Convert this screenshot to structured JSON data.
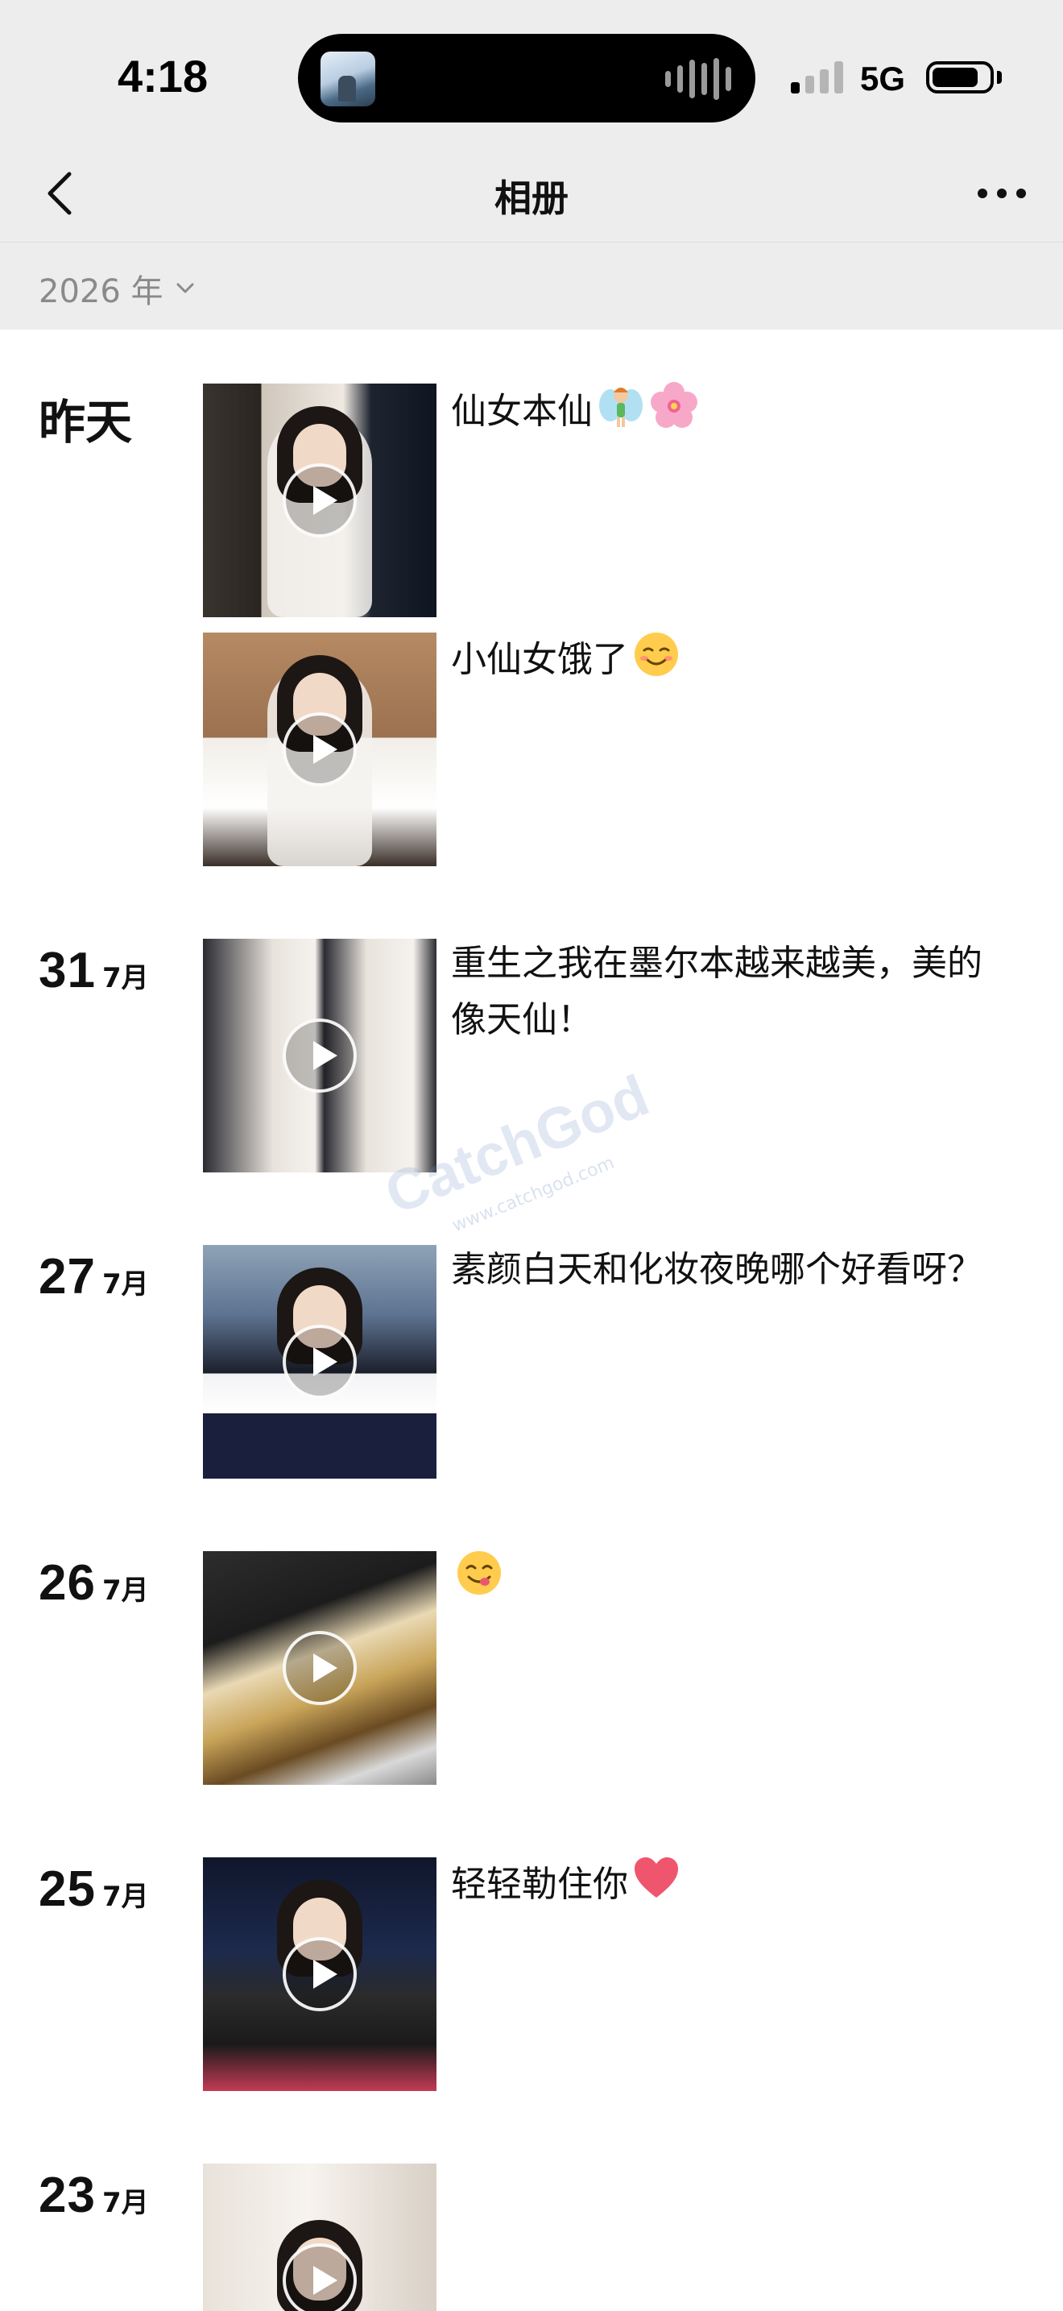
{
  "status_bar": {
    "time": "4:18",
    "network": "5G",
    "signal_bars_active": 1,
    "battery_level": 0.75
  },
  "nav": {
    "title": "相册",
    "back_icon": "chevron-left-icon",
    "more_icon": "ellipsis-icon"
  },
  "filter": {
    "year_label": "2026 年",
    "dropdown_icon": "chevron-down-icon"
  },
  "posts": [
    {
      "day": "昨天",
      "month": "",
      "caption": "仙女本仙",
      "emojis": [
        "fairy-emoji",
        "cherry-blossom-emoji"
      ]
    },
    {
      "day": "",
      "month": "",
      "caption": "小仙女饿了",
      "emojis": [
        "smiling-relieved-emoji"
      ]
    },
    {
      "day": "31",
      "month": "7月",
      "caption": "重生之我在墨尔本越来越美，美的像天仙！",
      "emojis": []
    },
    {
      "day": "27",
      "month": "7月",
      "caption": "素颜白天和化妆夜晚哪个好看呀？",
      "emojis": []
    },
    {
      "day": "26",
      "month": "7月",
      "caption": "",
      "emojis": [
        "yum-face-emoji"
      ]
    },
    {
      "day": "25",
      "month": "7月",
      "caption": "轻轻勒住你",
      "emojis": [
        "red-heart-emoji"
      ]
    },
    {
      "day": "23",
      "month": "7月",
      "caption": "",
      "emojis": []
    }
  ],
  "watermark": {
    "brand": "CatchGod",
    "url": "www.catchgod.com"
  },
  "colors": {
    "header_bg": "#ededed",
    "feed_bg": "#ffffff",
    "muted_text": "#8a8a8a"
  }
}
